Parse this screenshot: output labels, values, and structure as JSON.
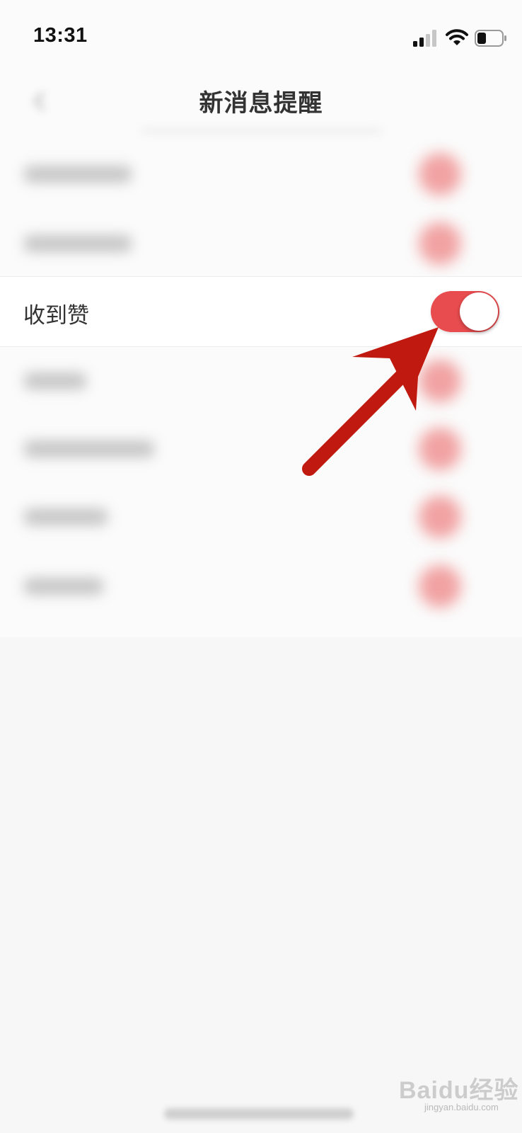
{
  "status_bar": {
    "time": "13:31",
    "icons": [
      "signal-icon",
      "wifi-icon",
      "battery-icon"
    ]
  },
  "nav": {
    "title": "新消息提醒",
    "back_icon": "chevron-left-icon"
  },
  "settings": {
    "focused_row": {
      "label": "收到赞",
      "toggle_on": true,
      "toggle_color": "#e84c4f"
    }
  },
  "overlay": {
    "arrow_color": "#c0190f"
  },
  "watermark": {
    "text": "Baidu经验",
    "sub": "jingyan.baidu.com"
  }
}
